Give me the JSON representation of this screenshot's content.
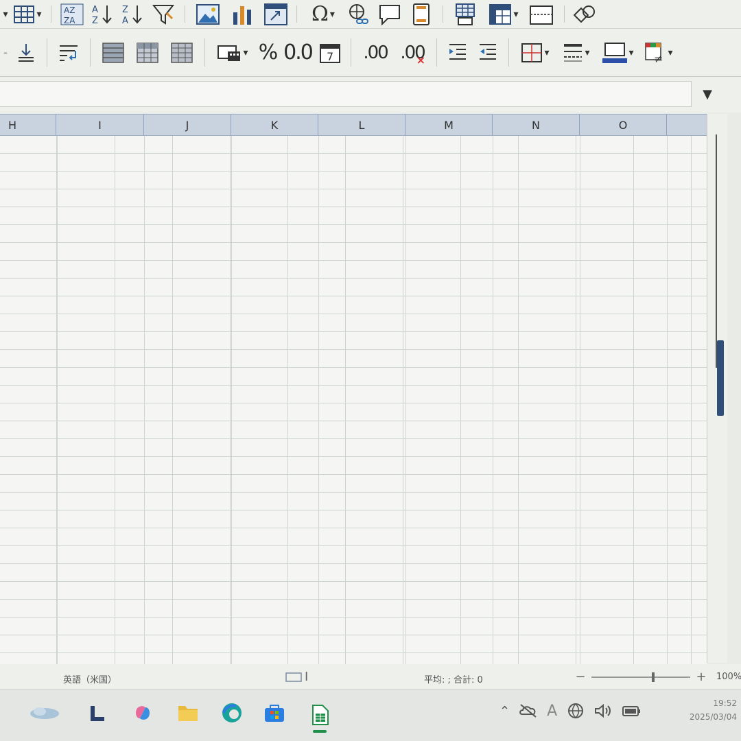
{
  "toolbar1": {
    "icons": [
      "table-grid-icon",
      "sort-icon",
      "sort-ascending-icon",
      "sort-descending-icon",
      "autofilter-icon",
      "insert-image-icon",
      "insert-chart-icon",
      "pivot-table-icon",
      "special-character-icon",
      "hyperlink-icon",
      "comment-icon",
      "headers-footers-icon",
      "define-print-area-icon",
      "freeze-rows-columns-icon",
      "split-window-icon",
      "show-draw-functions-icon"
    ]
  },
  "toolbar2": {
    "percent_label": "%",
    "decimal_label": "0.0",
    "add_decimal_label": ".00",
    "del_decimal_label": ".00",
    "calendar_label": "7"
  },
  "formula_bar": {
    "value": ""
  },
  "columns": [
    "H",
    "I",
    "J",
    "K",
    "L",
    "M",
    "N",
    "O"
  ],
  "status": {
    "language": "英語（米国）",
    "sum_text": "平均: ; 合計: 0",
    "zoom_percent": "100%"
  },
  "taskbar": {
    "time": "19:52",
    "date": "2025/03/04",
    "ime_indicator": "A"
  },
  "colors": {
    "accent": "#2f4f7a",
    "header_bg": "#c9d3e0",
    "excel_green": "#1f8f4a"
  }
}
